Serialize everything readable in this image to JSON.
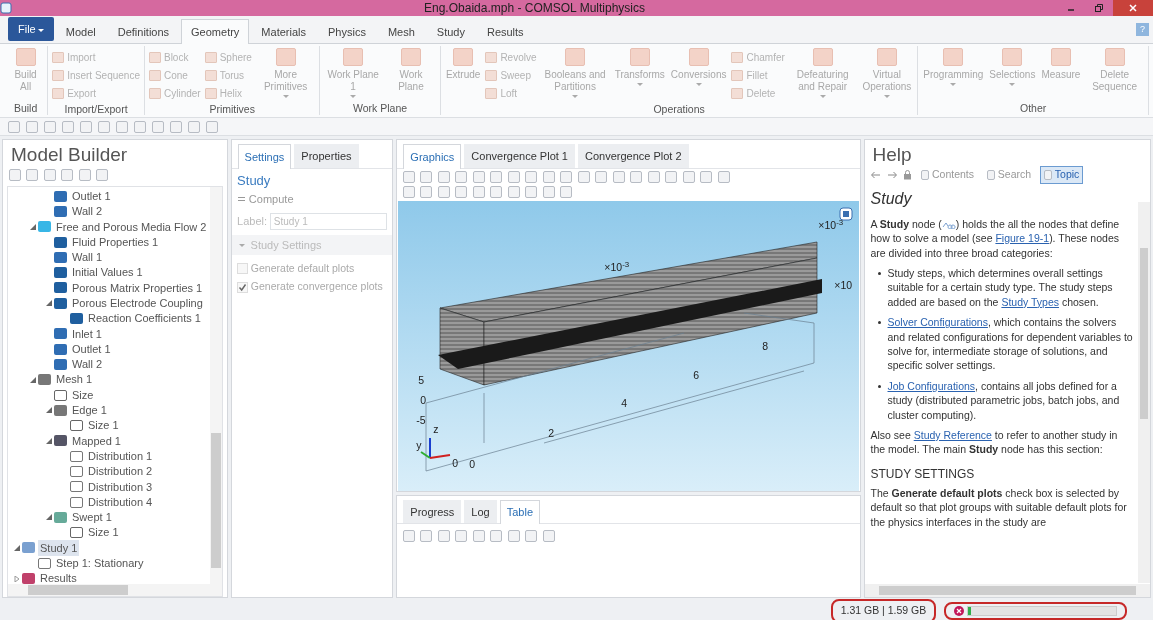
{
  "window": {
    "title": "Eng.Obaida.mph - COMSOL Multiphysics"
  },
  "file_menu": "File",
  "ribbon_tabs": [
    {
      "label": "Model",
      "selected": false
    },
    {
      "label": "Definitions",
      "selected": false
    },
    {
      "label": "Geometry",
      "selected": true
    },
    {
      "label": "Materials",
      "selected": false
    },
    {
      "label": "Physics",
      "selected": false
    },
    {
      "label": "Mesh",
      "selected": false
    },
    {
      "label": "Study",
      "selected": false
    },
    {
      "label": "Results",
      "selected": false
    }
  ],
  "help_button": "?",
  "ribbon_groups": [
    {
      "label": "Build",
      "items": [
        {
          "kind": "large",
          "label": "Build All",
          "dropdown": false
        }
      ]
    },
    {
      "label": "Import/Export",
      "items": [
        {
          "kind": "stack",
          "items": [
            "Import",
            "Insert Sequence",
            "Export"
          ]
        }
      ]
    },
    {
      "label": "Primitives",
      "items": [
        {
          "kind": "stack",
          "items": [
            "Block",
            "Cone",
            "Cylinder"
          ]
        },
        {
          "kind": "stack",
          "items": [
            "Sphere",
            "Torus",
            "Helix"
          ]
        },
        {
          "kind": "large",
          "label": "More Primitives",
          "dropdown": true
        }
      ]
    },
    {
      "label": "Work Plane",
      "items": [
        {
          "kind": "large",
          "label": "Work Plane 1",
          "dropdown": true
        },
        {
          "kind": "large",
          "label": "Work Plane",
          "dropdown": false
        }
      ]
    },
    {
      "label": "Operations",
      "items": [
        {
          "kind": "large",
          "label": "Extrude",
          "dropdown": false
        },
        {
          "kind": "stack",
          "items": [
            "Revolve",
            "Sweep",
            "Loft"
          ]
        },
        {
          "kind": "large",
          "label": "Booleans and Partitions",
          "dropdown": true
        },
        {
          "kind": "large",
          "label": "Transforms",
          "dropdown": true
        },
        {
          "kind": "large",
          "label": "Conversions",
          "dropdown": true
        },
        {
          "kind": "stack",
          "items": [
            "Chamfer",
            "Fillet",
            "Delete"
          ]
        },
        {
          "kind": "large",
          "label": "Defeaturing and Repair",
          "dropdown": true
        },
        {
          "kind": "large",
          "label": "Virtual Operations",
          "dropdown": true
        }
      ]
    },
    {
      "label": "Other",
      "items": [
        {
          "kind": "large",
          "label": "Programming",
          "dropdown": true
        },
        {
          "kind": "large",
          "label": "Selections",
          "dropdown": true
        },
        {
          "kind": "large",
          "label": "Measure",
          "dropdown": false
        },
        {
          "kind": "large",
          "label": "Delete Sequence",
          "dropdown": false
        }
      ]
    }
  ],
  "model_builder": {
    "title": "Model Builder",
    "tree": [
      {
        "children": [
          {
            "children": [
              {
                "label": "Outlet 1",
                "kind": "boundary",
                "selected": false
              },
              {
                "label": "Wall 2",
                "kind": "boundary",
                "selected": false
              }
            ]
          },
          {
            "label": "Free and Porous Media Flow 2",
            "kind": "physics",
            "expanded": true,
            "selected": false,
            "children": [
              {
                "label": "Fluid Properties 1",
                "kind": "domain",
                "selected": false
              },
              {
                "label": "Wall 1",
                "kind": "boundary",
                "selected": false
              },
              {
                "label": "Initial Values 1",
                "kind": "domain",
                "selected": false
              },
              {
                "label": "Porous Matrix Properties 1",
                "kind": "domain",
                "selected": false
              },
              {
                "label": "Porous Electrode Coupling",
                "kind": "domain",
                "expanded": true,
                "selected": false,
                "children": [
                  {
                    "label": "Reaction Coefficients 1",
                    "kind": "domain",
                    "selected": false
                  }
                ]
              },
              {
                "label": "Inlet 1",
                "kind": "boundary",
                "selected": false
              },
              {
                "label": "Outlet 1",
                "kind": "boundary",
                "selected": false
              },
              {
                "label": "Wall 2",
                "kind": "boundary",
                "selected": false
              }
            ]
          },
          {
            "label": "Mesh 1",
            "kind": "mesh",
            "expanded": true,
            "selected": false,
            "children": [
              {
                "label": "Size",
                "kind": "size",
                "selected": false
              },
              {
                "label": "Edge 1",
                "kind": "mesh",
                "expanded": true,
                "selected": false,
                "children": [
                  {
                    "label": "Size 1",
                    "kind": "size",
                    "selected": false
                  }
                ]
              },
              {
                "label": "Mapped 1",
                "kind": "mapped",
                "expanded": true,
                "selected": false,
                "children": [
                  {
                    "label": "Distribution 1",
                    "kind": "distribution",
                    "selected": false
                  },
                  {
                    "label": "Distribution 2",
                    "kind": "distribution",
                    "selected": false
                  },
                  {
                    "label": "Distribution 3",
                    "kind": "distribution",
                    "selected": false
                  },
                  {
                    "label": "Distribution 4",
                    "kind": "distribution",
                    "selected": false
                  }
                ]
              },
              {
                "label": "Swept 1",
                "kind": "swept",
                "expanded": true,
                "selected": false,
                "children": [
                  {
                    "label": "Size 1",
                    "kind": "size",
                    "selected": false
                  }
                ]
              }
            ]
          }
        ]
      },
      {
        "label": "Study 1",
        "kind": "study",
        "expanded": true,
        "selected": true,
        "children": [
          {
            "label": "Step 1: Stationary",
            "kind": "step",
            "selected": false
          }
        ]
      },
      {
        "label": "Results",
        "kind": "results",
        "expanded": false,
        "selected": false
      }
    ]
  },
  "settings": {
    "tabs": [
      {
        "label": "Settings",
        "selected": true
      },
      {
        "label": "Properties",
        "selected": false
      }
    ],
    "title": "Study",
    "compute": "Compute",
    "label_caption": "Label:",
    "label_value": "Study 1",
    "section": {
      "title": "Study Settings",
      "expanded": true
    },
    "checkboxes": [
      {
        "label": "Generate default plots",
        "checked": false
      },
      {
        "label": "Generate convergence plots",
        "checked": true
      }
    ]
  },
  "graphics": {
    "tabs": [
      {
        "label": "Graphics",
        "selected": true
      },
      {
        "label": "Convergence Plot 1",
        "selected": false
      },
      {
        "label": "Convergence Plot 2",
        "selected": false
      }
    ],
    "plot_labels": [
      {
        "text": "×10$^{-3}$"
      },
      {
        "text": "×10$^{-3}$"
      },
      {
        "text": "×10"
      },
      {
        "text": "5"
      },
      {
        "text": "0"
      },
      {
        "text": "-5"
      },
      {
        "text": "2"
      },
      {
        "text": "4"
      },
      {
        "text": "6"
      },
      {
        "text": "8"
      },
      {
        "text": "0"
      },
      {
        "text": "0"
      },
      {
        "text": "z"
      },
      {
        "text": "y"
      }
    ]
  },
  "results_panel": {
    "tabs": [
      {
        "label": "Progress",
        "selected": false
      },
      {
        "label": "Log",
        "selected": false
      },
      {
        "label": "Table",
        "selected": true
      }
    ]
  },
  "help": {
    "title": "Help",
    "nav": [
      {
        "label": "Contents",
        "selected": false
      },
      {
        "label": "Search",
        "selected": false
      },
      {
        "label": "Topic",
        "selected": true
      }
    ],
    "heading": "Study",
    "blocks": [
      {
        "kind": "paragraph",
        "segments": [
          {
            "kind": "text",
            "text": "A **Study** node ("
          },
          {
            "kind": "icon"
          },
          {
            "kind": "text",
            "text": ") holds the all the nodes that define how to solve a model (see "
          },
          {
            "kind": "link",
            "text": "Figure 19-1"
          },
          {
            "kind": "text",
            "text": "). These nodes are divided into three broad categories:"
          }
        ]
      },
      {
        "kind": "bullet",
        "segments": [
          {
            "kind": "text",
            "text": "Study steps, which determines overall settings suitable for a certain study type. The study steps added are based on the "
          },
          {
            "kind": "link",
            "text": "Study Types"
          },
          {
            "kind": "text",
            "text": " chosen."
          }
        ]
      },
      {
        "kind": "bullet",
        "segments": [
          {
            "kind": "link",
            "text": "Solver Configurations"
          },
          {
            "kind": "text",
            "text": ", which contains the solvers and related configurations for dependent variables to solve for, intermediate storage of solutions, and specific solver settings."
          }
        ]
      },
      {
        "kind": "bullet",
        "segments": [
          {
            "kind": "link",
            "text": "Job Configurations"
          },
          {
            "kind": "text",
            "text": ", contains all jobs defined for a study (distributed parametric jobs, batch jobs, and cluster computing)."
          }
        ]
      },
      {
        "kind": "paragraph",
        "segments": [
          {
            "kind": "text",
            "text": "Also see "
          },
          {
            "kind": "link",
            "text": "Study Reference"
          },
          {
            "kind": "text",
            "text": " to refer to another study in the model. The main **Study** node has this section:"
          }
        ]
      },
      {
        "kind": "section",
        "segments": [
          {
            "kind": "text",
            "text": "STUDY SETTINGS"
          }
        ]
      },
      {
        "kind": "paragraph",
        "segments": [
          {
            "kind": "text",
            "text": "The **Generate default plots** check box is selected by default so that plot groups with suitable default plots for the physics interfaces in the study are"
          }
        ]
      }
    ]
  },
  "status_bar": {
    "memory": "1.31 GB | 1.59 GB",
    "progress": {
      "level": 0.02
    }
  }
}
